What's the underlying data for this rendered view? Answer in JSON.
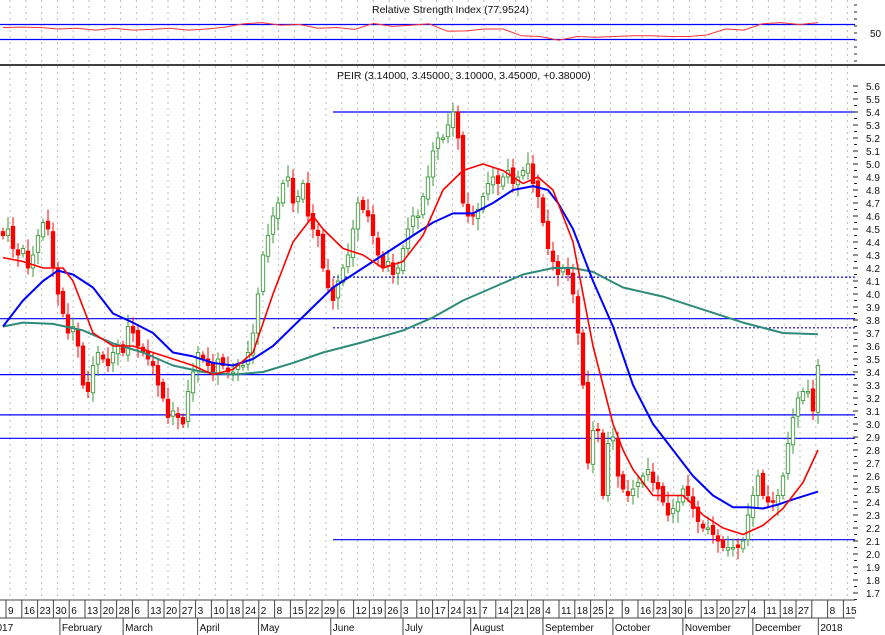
{
  "chart_data": {
    "type": "candlestick",
    "rsi_panel": {
      "title": "Relative Strength Index (77.9524)",
      "axis_label": "50",
      "levels": [
        70,
        30
      ],
      "range": [
        10,
        90
      ],
      "values": [
        62,
        63,
        62,
        58,
        60,
        55,
        60,
        55,
        57,
        60,
        55,
        58,
        63,
        72,
        75,
        68,
        70,
        60,
        62,
        57,
        73,
        65,
        68,
        72,
        52,
        53,
        58,
        58,
        40,
        38,
        28,
        38,
        36,
        38,
        40,
        40,
        38,
        38,
        42,
        58,
        55,
        72,
        75,
        70,
        75
      ]
    },
    "price_panel": {
      "title": "PEIR (3.14000, 3.45000, 3.10000, 3.45000, +0.38000)",
      "ylim": [
        1.65,
        5.75
      ],
      "yticks": [
        "5.6",
        "5.5",
        "5.4",
        "5.3",
        "5.2",
        "5.1",
        "5.0",
        "4.9",
        "4.8",
        "4.7",
        "4.6",
        "4.5",
        "4.4",
        "4.3",
        "4.2",
        "4.1",
        "4.0",
        "3.9",
        "3.8",
        "3.7",
        "3.6",
        "3.5",
        "3.4",
        "3.3",
        "3.2",
        "3.1",
        "3.0",
        "2.9",
        "2.8",
        "2.7",
        "2.6",
        "2.5",
        "2.4",
        "2.3",
        "2.2",
        "2.1",
        "2.0",
        "1.9",
        "1.8",
        "1.7"
      ],
      "close": [
        4.45,
        4.5,
        4.35,
        4.3,
        4.35,
        4.2,
        4.3,
        4.45,
        4.55,
        4.5,
        4.2,
        4.0,
        3.85,
        3.7,
        3.75,
        3.6,
        3.3,
        3.25,
        3.45,
        3.55,
        3.5,
        3.45,
        3.55,
        3.6,
        3.55,
        3.75,
        3.7,
        3.6,
        3.55,
        3.5,
        3.45,
        3.3,
        3.2,
        3.05,
        3.1,
        3.05,
        3.0,
        3.25,
        3.4,
        3.55,
        3.5,
        3.45,
        3.4,
        3.5,
        3.45,
        3.4,
        3.4,
        3.45,
        3.45,
        3.55,
        3.7,
        4.0,
        4.3,
        4.45,
        4.6,
        4.7,
        4.85,
        4.9,
        4.7,
        4.75,
        4.85,
        4.6,
        4.5,
        4.45,
        4.2,
        4.05,
        3.95,
        4.1,
        4.2,
        4.3,
        4.5,
        4.7,
        4.65,
        4.6,
        4.45,
        4.3,
        4.2,
        4.25,
        4.15,
        4.2,
        4.35,
        4.5,
        4.6,
        4.6,
        4.75,
        4.9,
        5.1,
        5.2,
        5.2,
        5.3,
        5.4,
        5.2,
        4.7,
        4.6,
        4.6,
        4.65,
        4.75,
        4.85,
        4.9,
        4.85,
        4.9,
        4.95,
        4.85,
        4.9,
        4.95,
        5.0,
        4.85,
        4.75,
        4.55,
        4.35,
        4.25,
        4.15,
        4.2,
        4.15,
        4.0,
        3.7,
        3.3,
        2.7,
        2.95,
        2.95,
        2.45,
        2.85,
        2.9,
        2.6,
        2.5,
        2.45,
        2.5,
        2.55,
        2.6,
        2.65,
        2.55,
        2.5,
        2.4,
        2.3,
        2.35,
        2.4,
        2.5,
        2.45,
        2.35,
        2.25,
        2.2,
        2.2,
        2.15,
        2.1,
        2.05,
        2.05,
        2.05,
        2.05,
        2.1,
        2.3,
        2.45,
        2.6,
        2.45,
        2.4,
        2.4,
        2.45,
        2.6,
        2.85,
        3.05,
        3.2,
        3.25,
        3.25,
        3.1,
        3.45
      ],
      "ma_short": [
        [
          0,
          4.28
        ],
        [
          4,
          4.25
        ],
        [
          8,
          4.2
        ],
        [
          12,
          4.2
        ],
        [
          14,
          4.1
        ],
        [
          18,
          3.7
        ],
        [
          22,
          3.6
        ],
        [
          26,
          3.6
        ],
        [
          30,
          3.55
        ],
        [
          34,
          3.5
        ],
        [
          38,
          3.45
        ],
        [
          42,
          3.38
        ],
        [
          46,
          3.42
        ],
        [
          50,
          3.55
        ],
        [
          54,
          4.0
        ],
        [
          58,
          4.4
        ],
        [
          62,
          4.6
        ],
        [
          64,
          4.5
        ],
        [
          68,
          4.35
        ],
        [
          72,
          4.3
        ],
        [
          76,
          4.2
        ],
        [
          80,
          4.25
        ],
        [
          84,
          4.45
        ],
        [
          88,
          4.8
        ],
        [
          92,
          4.95
        ],
        [
          96,
          5.0
        ],
        [
          100,
          4.95
        ],
        [
          104,
          4.85
        ],
        [
          107,
          4.9
        ],
        [
          110,
          4.8
        ],
        [
          112,
          4.6
        ],
        [
          114,
          4.4
        ],
        [
          116,
          4.0
        ],
        [
          118,
          3.6
        ],
        [
          120,
          3.3
        ],
        [
          122,
          3.0
        ],
        [
          124,
          2.8
        ],
        [
          126,
          2.65
        ],
        [
          128,
          2.55
        ],
        [
          130,
          2.45
        ],
        [
          132,
          2.45
        ],
        [
          134,
          2.45
        ],
        [
          136,
          2.45
        ],
        [
          138,
          2.38
        ],
        [
          140,
          2.3
        ],
        [
          144,
          2.2
        ],
        [
          148,
          2.15
        ],
        [
          152,
          2.22
        ],
        [
          156,
          2.35
        ],
        [
          160,
          2.55
        ],
        [
          163,
          2.8
        ]
      ],
      "ma_mid": [
        [
          0,
          3.75
        ],
        [
          4,
          3.95
        ],
        [
          8,
          4.1
        ],
        [
          11,
          4.18
        ],
        [
          14,
          4.15
        ],
        [
          18,
          4.05
        ],
        [
          22,
          3.85
        ],
        [
          26,
          3.78
        ],
        [
          30,
          3.7
        ],
        [
          34,
          3.55
        ],
        [
          38,
          3.52
        ],
        [
          42,
          3.47
        ],
        [
          46,
          3.45
        ],
        [
          50,
          3.5
        ],
        [
          54,
          3.6
        ],
        [
          58,
          3.75
        ],
        [
          62,
          3.9
        ],
        [
          66,
          4.05
        ],
        [
          70,
          4.15
        ],
        [
          74,
          4.25
        ],
        [
          78,
          4.35
        ],
        [
          82,
          4.45
        ],
        [
          86,
          4.55
        ],
        [
          90,
          4.62
        ],
        [
          94,
          4.62
        ],
        [
          98,
          4.7
        ],
        [
          102,
          4.8
        ],
        [
          106,
          4.83
        ],
        [
          109,
          4.8
        ],
        [
          111,
          4.7
        ],
        [
          114,
          4.5
        ],
        [
          118,
          4.1
        ],
        [
          122,
          3.75
        ],
        [
          126,
          3.3
        ],
        [
          130,
          3.0
        ],
        [
          134,
          2.8
        ],
        [
          138,
          2.6
        ],
        [
          142,
          2.45
        ],
        [
          146,
          2.36
        ],
        [
          149,
          2.36
        ],
        [
          152,
          2.35
        ],
        [
          155,
          2.38
        ],
        [
          158,
          2.42
        ],
        [
          163,
          2.48
        ]
      ],
      "ma_long": [
        [
          0,
          3.75
        ],
        [
          4,
          3.78
        ],
        [
          10,
          3.77
        ],
        [
          16,
          3.72
        ],
        [
          22,
          3.62
        ],
        [
          28,
          3.55
        ],
        [
          34,
          3.45
        ],
        [
          40,
          3.4
        ],
        [
          46,
          3.38
        ],
        [
          52,
          3.4
        ],
        [
          58,
          3.47
        ],
        [
          64,
          3.55
        ],
        [
          72,
          3.63
        ],
        [
          80,
          3.72
        ],
        [
          86,
          3.82
        ],
        [
          92,
          3.95
        ],
        [
          98,
          4.05
        ],
        [
          104,
          4.15
        ],
        [
          110,
          4.2
        ],
        [
          114,
          4.2
        ],
        [
          118,
          4.17
        ],
        [
          124,
          4.05
        ],
        [
          132,
          3.98
        ],
        [
          140,
          3.88
        ],
        [
          148,
          3.78
        ],
        [
          156,
          3.7
        ],
        [
          163,
          3.69
        ]
      ],
      "hlines": [
        {
          "price": 5.4,
          "from_index": 66,
          "style": "solid"
        },
        {
          "price": 4.13,
          "from_index": 66,
          "style": "dotted"
        },
        {
          "price": 3.81,
          "from_index": 0,
          "style": "solid"
        },
        {
          "price": 3.74,
          "from_index": 66,
          "style": "dotted"
        },
        {
          "price": 3.38,
          "from_index": 0,
          "style": "solid"
        },
        {
          "price": 3.38,
          "from_index": 66,
          "style": "dotted"
        },
        {
          "price": 3.07,
          "from_index": 0,
          "style": "solid"
        },
        {
          "price": 2.89,
          "from_index": 0,
          "style": "solid"
        },
        {
          "price": 2.11,
          "from_index": 66,
          "style": "solid"
        }
      ]
    },
    "x_axis": {
      "week_labels": [
        "9",
        "16",
        "23",
        "30",
        "6",
        "13",
        "20",
        "28",
        "6",
        "13",
        "20",
        "27",
        "3",
        "10",
        "18",
        "24",
        "2",
        "8",
        "15",
        "22",
        "29",
        "6",
        "12",
        "19",
        "26",
        "3",
        "10",
        "17",
        "24",
        "31",
        "7",
        "14",
        "21",
        "28",
        "4",
        "11",
        "18",
        "25",
        "2",
        "9",
        "16",
        "23",
        "30",
        "6",
        "13",
        "20",
        "27",
        "4",
        "11",
        "18",
        "27",
        "",
        "8",
        "15"
      ],
      "months": [
        {
          "label": "017",
          "day_offset": -6
        },
        {
          "label": "February",
          "day_offset": 23
        },
        {
          "label": "March",
          "day_offset": 51
        },
        {
          "label": "April",
          "day_offset": 84
        },
        {
          "label": "May",
          "day_offset": 111
        },
        {
          "label": "June",
          "day_offset": 143
        },
        {
          "label": "July",
          "day_offset": 175
        },
        {
          "label": "August",
          "day_offset": 205
        },
        {
          "label": "September",
          "day_offset": 237
        },
        {
          "label": "October",
          "day_offset": 268
        },
        {
          "label": "November",
          "day_offset": 299
        },
        {
          "label": "December",
          "day_offset": 330
        },
        {
          "label": "2018",
          "day_offset": 359
        }
      ]
    },
    "colors": {
      "up": "#3a9a3a",
      "down": "#ff0000",
      "ma_short": "#ff0000",
      "ma_mid": "#0000ff",
      "ma_long": "#2e8b7a",
      "levels": "#0000ff",
      "rsi": "#ff3333"
    }
  }
}
